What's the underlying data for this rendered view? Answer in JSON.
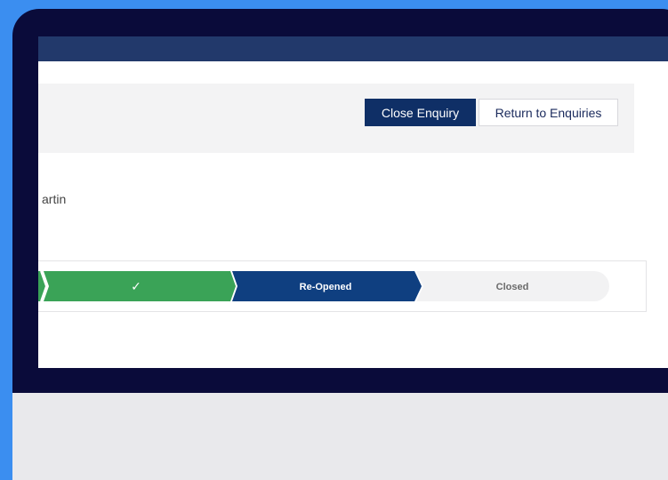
{
  "enquiry": {
    "close_button": "Close Enquiry",
    "return_button": "Return to Enquiries",
    "name_fragment": "artin"
  },
  "progress": {
    "steps": [
      {
        "label": "",
        "status": "complete",
        "color": "#3aa357"
      },
      {
        "label": "✓",
        "status": "complete",
        "color": "#3aa357"
      },
      {
        "label": "Re-Opened",
        "status": "current",
        "color": "#0f3f80"
      },
      {
        "label": "Closed",
        "status": "pending",
        "color": "#f2f2f3"
      }
    ]
  },
  "colors": {
    "background": "#3b8ef0",
    "bezel": "#0a0b3a",
    "topbar": "#22396b",
    "primary_button": "#0f2f66"
  }
}
